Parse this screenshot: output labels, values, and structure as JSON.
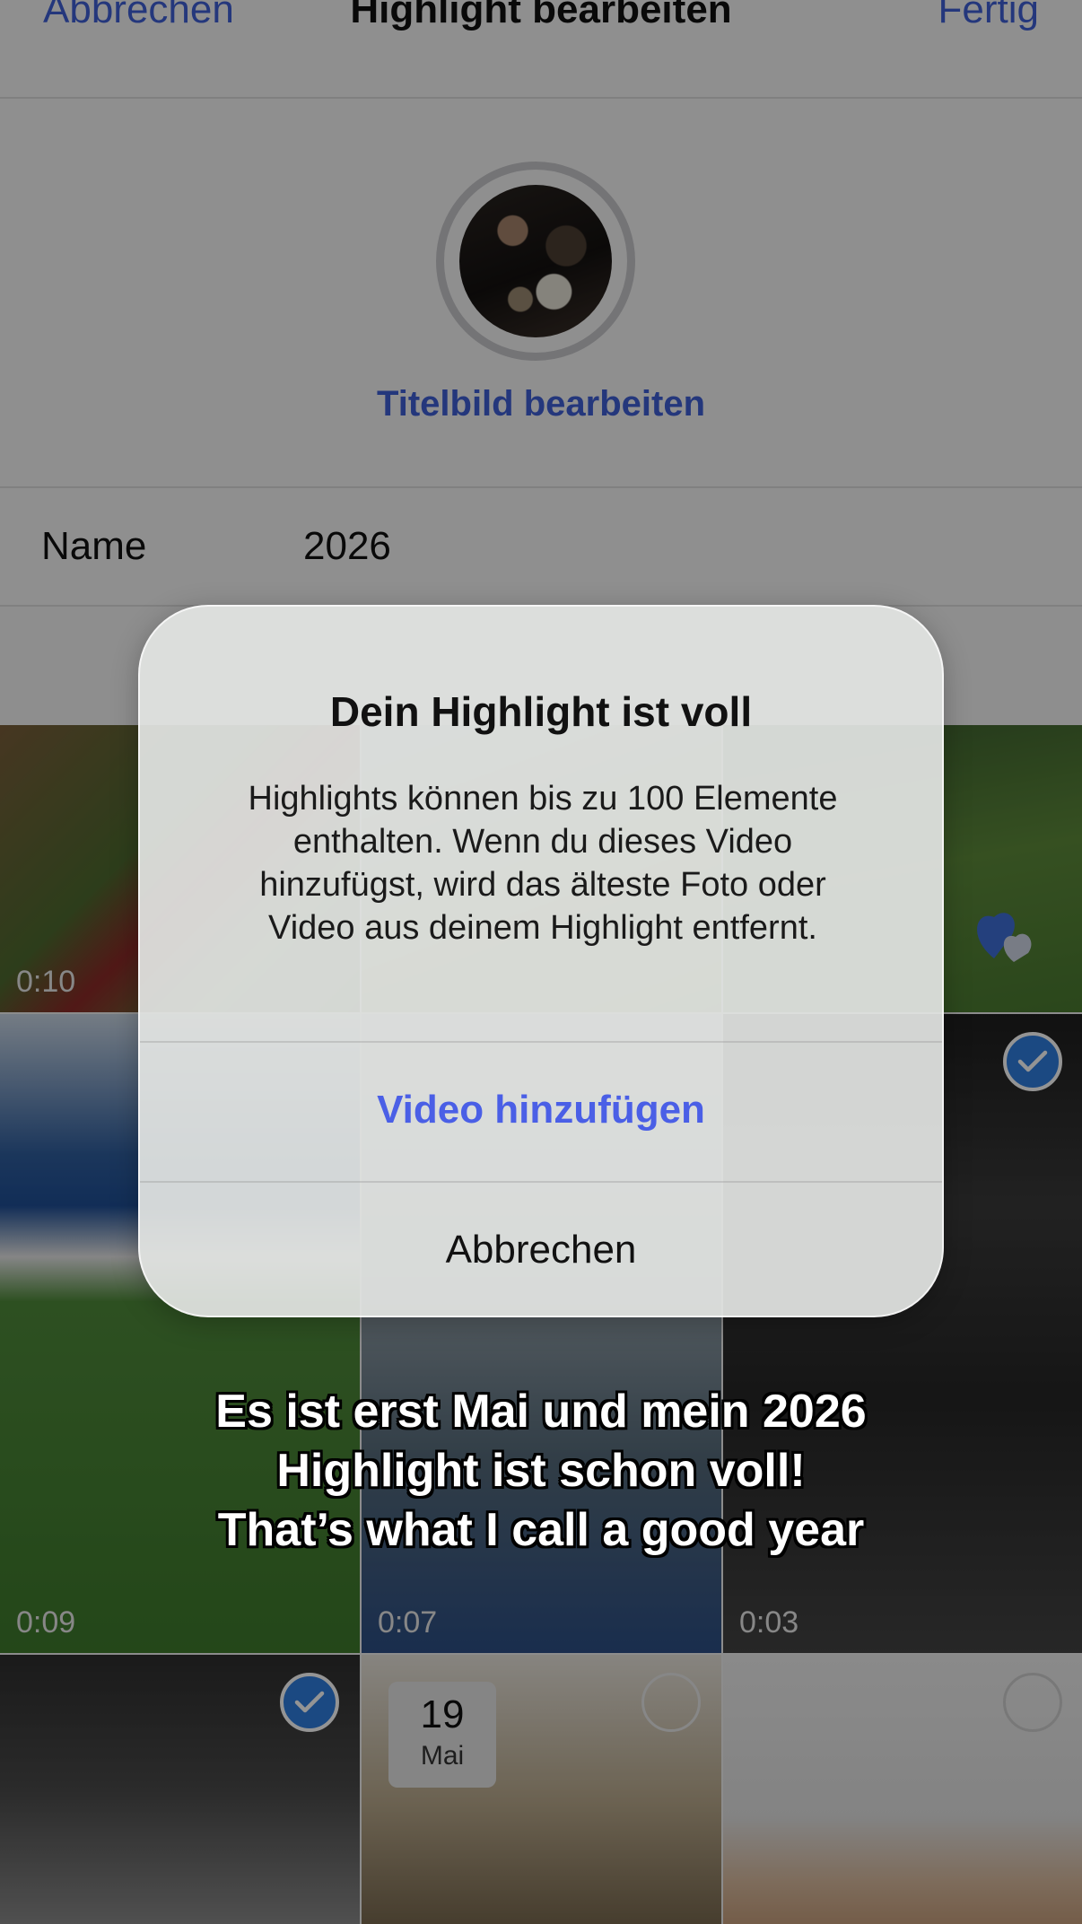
{
  "header": {
    "cancel_label": "Abbrechen",
    "title": "Highlight bearbeiten",
    "done_label": "Fertig"
  },
  "cover": {
    "edit_label": "Titelbild bearbeiten"
  },
  "name_field": {
    "label": "Name",
    "value": "2026"
  },
  "media": {
    "tiles": [
      {
        "duration": "0:10"
      },
      {
        "duration": "0:09"
      },
      {
        "duration": "0:07"
      },
      {
        "duration": "0:03"
      },
      {
        "date_day": "19",
        "date_month": "Mai"
      }
    ]
  },
  "alert": {
    "title": "Dein Highlight ist voll",
    "message": "Highlights können bis zu 100 Elemente\nenthalten. Wenn du dieses Video\nhinzufügst, wird das älteste Foto oder\nVideo aus deinem Highlight entfernt.",
    "primary_label": "Video hinzufügen",
    "cancel_label": "Abbrechen"
  },
  "caption": {
    "line1": "Es ist erst Mai und mein 2026",
    "line2": "Highlight ist schon voll!",
    "line3": "That’s what I call a good year"
  },
  "colors": {
    "accent": "#3f5fd6",
    "alert_button": "#4a5fe6",
    "check_blue": "#2f7fe0"
  }
}
